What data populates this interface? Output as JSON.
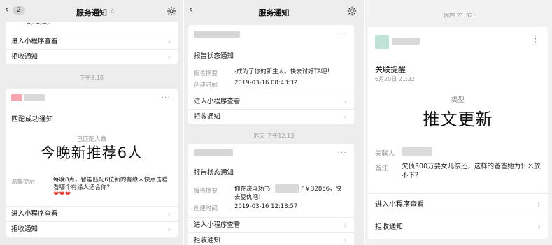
{
  "panel1": {
    "back_count": "2",
    "title": "服务通知",
    "muted": "ǒ",
    "top_partial_text": "～  ～～",
    "top_card_rows": [
      "进入小程序查看",
      "拒收通知"
    ],
    "timestamp": "下午9:18",
    "card": {
      "more": "···",
      "heading": "匹配成功通知",
      "matched_label": "已匹配人数",
      "big_text": "今晚新推荐6人",
      "hint_label": "温馨提示",
      "hint_text": "每晚8点，智能匹配6位新的有缘人快点击看看哪个有缘人适合你？",
      "hearts": "❤❤❤",
      "rows": [
        "进入小程序查看",
        "拒收通知"
      ]
    },
    "chevron": "›"
  },
  "panel2": {
    "title": "服务通知",
    "card1": {
      "more": "···",
      "heading": "报告状态通知",
      "summary_label": "报告摘要",
      "summary_value": "-成为了你的新主人。快去讨好TA吧！",
      "time_label": "创建时间",
      "time_value": "2019-03-16 08:43:32",
      "rows": [
        "进入小程序查看",
        "拒收通知"
      ]
    },
    "timestamp": "昨天 下午12:13",
    "card2": {
      "more": "···",
      "heading": "报告状态通知",
      "summary_label": "报告摘要",
      "summary_value_a": "你在决斗场书",
      "summary_value_b": "了￥32856，快",
      "summary_value_c": "去复仇吧！",
      "time_label": "创建时间",
      "time_value": "2019-03-16 12:13:57",
      "rows": [
        "进入小程序查看",
        "拒收通知"
      ]
    },
    "chevron": "›"
  },
  "panel3": {
    "timestamp": "周四 21:32",
    "card": {
      "more": "⋮",
      "heading": "关联提醒",
      "date": "6月20日 21:32",
      "type_label": "类型",
      "big_text": "推文更新",
      "related_label": "关联人",
      "note_label": "备注",
      "note_value": "欠债300万要女儿偿还，这样的爸爸她为什么放不下？",
      "rows": [
        "进入小程序查看",
        "拒收通知"
      ]
    },
    "chevron": "›"
  },
  "colors": {
    "heart": "#e8413c",
    "blur_pink": "#f4b9c2",
    "blur_green": "#c3dfd3",
    "blur_gray": "#d8d8d8"
  }
}
